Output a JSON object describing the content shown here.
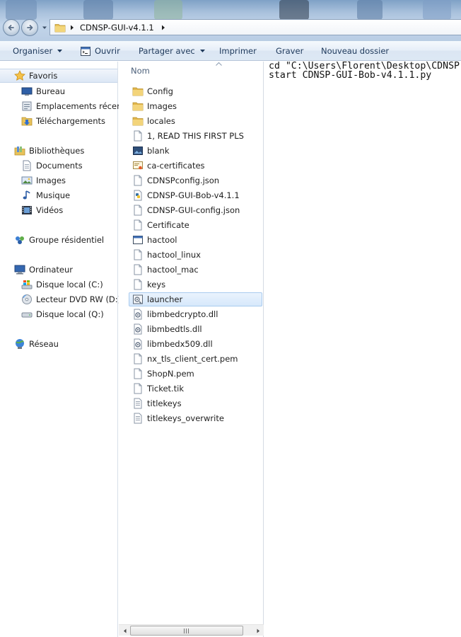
{
  "address_bar": {
    "breadcrumb": "CDNSP-GUI-v4.1.1"
  },
  "toolbar": {
    "organiser": "Organiser",
    "ouvrir": "Ouvrir",
    "partager": "Partager avec",
    "imprimer": "Imprimer",
    "graver": "Graver",
    "nouveau_dossier": "Nouveau dossier"
  },
  "nav": {
    "favoris": "Favoris",
    "bureau": "Bureau",
    "emplacements": "Emplacements récents",
    "telechargements": "Téléchargements",
    "bibliotheques": "Bibliothèques",
    "documents": "Documents",
    "images": "Images",
    "musique": "Musique",
    "videos": "Vidéos",
    "groupe": "Groupe résidentiel",
    "ordinateur": "Ordinateur",
    "disque_c": "Disque local (C:)",
    "lecteur_dvd": "Lecteur DVD RW (D:) A",
    "disque_q": "Disque local (Q:)",
    "reseau": "Réseau"
  },
  "files": {
    "column_header": "Nom",
    "items": [
      {
        "name": "Config",
        "icon": "folder-icon"
      },
      {
        "name": "Images",
        "icon": "folder-icon"
      },
      {
        "name": "locales",
        "icon": "folder-icon"
      },
      {
        "name": "1, READ THIS FIRST PLS",
        "icon": "document-icon"
      },
      {
        "name": "blank",
        "icon": "image-file-icon"
      },
      {
        "name": "ca-certificates",
        "icon": "certificate-icon"
      },
      {
        "name": "CDNSPconfig.json",
        "icon": "document-icon"
      },
      {
        "name": "CDNSP-GUI-Bob-v4.1.1",
        "icon": "python-file-icon"
      },
      {
        "name": "CDNSP-GUI-config.json",
        "icon": "document-icon"
      },
      {
        "name": "Certificate",
        "icon": "document-icon"
      },
      {
        "name": "hactool",
        "icon": "application-icon"
      },
      {
        "name": "hactool_linux",
        "icon": "document-icon"
      },
      {
        "name": "hactool_mac",
        "icon": "document-icon"
      },
      {
        "name": "keys",
        "icon": "document-icon"
      },
      {
        "name": "launcher",
        "icon": "batch-file-icon",
        "selected": true
      },
      {
        "name": "libmbedcrypto.dll",
        "icon": "dll-file-icon"
      },
      {
        "name": "libmbedtls.dll",
        "icon": "dll-file-icon"
      },
      {
        "name": "libmbedx509.dll",
        "icon": "dll-file-icon"
      },
      {
        "name": "nx_tls_client_cert.pem",
        "icon": "document-icon"
      },
      {
        "name": "ShopN.pem",
        "icon": "document-icon"
      },
      {
        "name": "Ticket.tik",
        "icon": "document-icon"
      },
      {
        "name": "titlekeys",
        "icon": "text-file-icon"
      },
      {
        "name": "titlekeys_overwrite",
        "icon": "text-file-icon"
      }
    ]
  },
  "text_pane": {
    "line1": "cd \"C:\\Users\\Florent\\Desktop\\CDNSP",
    "line2": "start CDNSP-GUI-Bob-v4.1.1.py"
  },
  "colors": {
    "title_bar": "#a9c1dc",
    "toolbar": "#e6eef8",
    "toolbar_text": "#1e395b",
    "selection": "#d6e8fb",
    "folder": "#e8c25a"
  }
}
